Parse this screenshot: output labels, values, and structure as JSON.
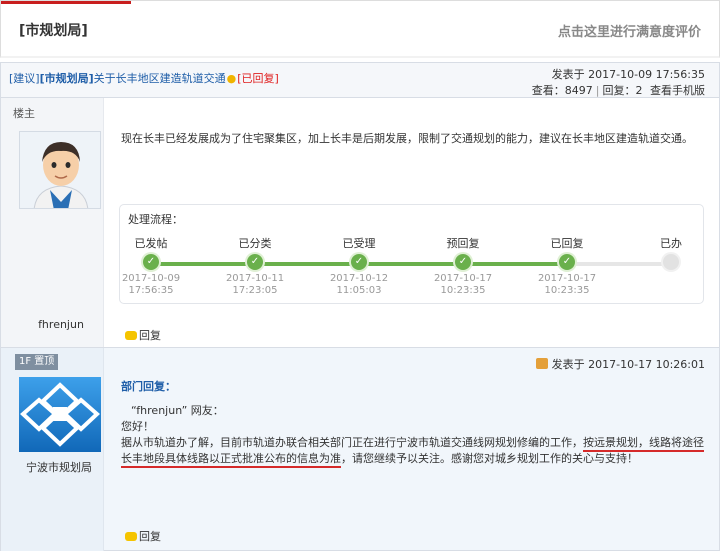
{
  "header": {
    "bureau": "[市规划局]",
    "survey_link": "点击这里进行满意度评价"
  },
  "thread": {
    "type_tag": "[建议]",
    "bureau_tag": "[市规划局]",
    "title": "关于长丰地区建造轨道交通",
    "status": "[已回复]",
    "posted_label": "发表于",
    "posted_time": "2017-10-09 17:56:35",
    "views_label": "查看：",
    "views": "8497",
    "replies_label": "回复：",
    "replies": "2",
    "mobile_link": "查看手机版"
  },
  "op": {
    "role": "楼主",
    "username": "fhrenjun",
    "content": "现在长丰已经发展成为了住宅聚集区，加上长丰是后期发展，限制了交通规划的能力，建议在长丰地区建造轨道交通。",
    "flow_title": "处理流程：",
    "steps": [
      {
        "label": "已发帖",
        "date": "2017-10-09",
        "time": "17:56:35",
        "done": true
      },
      {
        "label": "已分类",
        "date": "2017-10-11",
        "time": "17:23:05",
        "done": true
      },
      {
        "label": "已受理",
        "date": "2017-10-12",
        "time": "11:05:03",
        "done": true
      },
      {
        "label": "预回复",
        "date": "2017-10-17",
        "time": "10:23:35",
        "done": true
      },
      {
        "label": "已回复",
        "date": "2017-10-17",
        "time": "10:23:35",
        "done": true
      },
      {
        "label": "已办",
        "date": "",
        "time": "",
        "done": false
      }
    ],
    "reply_button": "回复",
    "check_glyph": "✓",
    "colors": {
      "done": "#6ab04c",
      "pending": "#e2e2e2"
    }
  },
  "reply": {
    "floor": "1F 置顶",
    "username": "宁波市规划局",
    "posted_label": "发表于",
    "posted_time": "2017-10-17 10:26:01",
    "dept_title": "部门回复：",
    "greeting_to": "“fhrenjun” 网友：",
    "hello": "您好！",
    "body_part1": "据从市轨道办了解，目前市轨道办联合相关部门正在进行宁波市轨道交通线网规划修编的工作，",
    "body_underline1": "按远景规划，线路",
    "body_underline2": "将途径长丰地段具体线路以正式批准公布的信息为准",
    "body_part2": "，请您继续予以关注。感谢您对城乡规划工作的关心与支持！",
    "reply_button": "回复"
  }
}
